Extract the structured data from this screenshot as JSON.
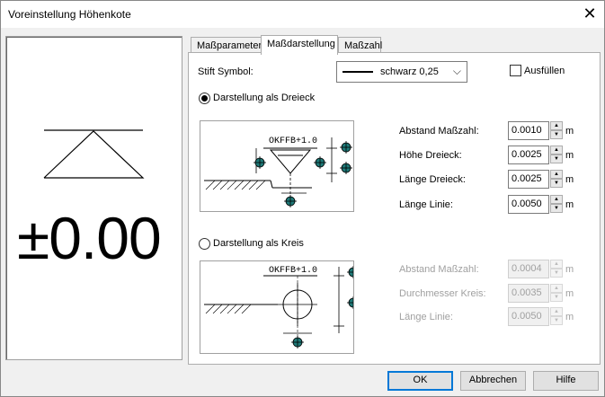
{
  "window": {
    "title": "Voreinstellung Höhenkote"
  },
  "preview": {
    "value": "±0.00"
  },
  "tabs": [
    {
      "label": "Maßparameter"
    },
    {
      "label": "Maßdarstellung"
    },
    {
      "label": "Maßzahl"
    }
  ],
  "pen": {
    "label": "Stift Symbol:",
    "value": "schwarz 0,25"
  },
  "fill": {
    "label": "Ausfüllen",
    "checked": false
  },
  "triangle": {
    "label": "Darstellung als Dreieck",
    "selected": true,
    "diagram_text": "OKFFB+1.0",
    "fields": [
      {
        "label": "Abstand Maßzahl:",
        "value": "0.0010",
        "unit": "m"
      },
      {
        "label": "Höhe Dreieck:",
        "value": "0.0025",
        "unit": "m"
      },
      {
        "label": "Länge Dreieck:",
        "value": "0.0025",
        "unit": "m"
      },
      {
        "label": "Länge Linie:",
        "value": "0.0050",
        "unit": "m"
      }
    ]
  },
  "circle": {
    "label": "Darstellung als Kreis",
    "selected": false,
    "diagram_text": "OKFFB+1.0",
    "fields": [
      {
        "label": "Abstand Maßzahl:",
        "value": "0.0004",
        "unit": "m"
      },
      {
        "label": "Durchmesser Kreis:",
        "value": "0.0035",
        "unit": "m"
      },
      {
        "label": "Länge Linie:",
        "value": "0.0050",
        "unit": "m"
      }
    ]
  },
  "buttons": {
    "ok": "OK",
    "cancel": "Abbrechen",
    "help": "Hilfe"
  }
}
